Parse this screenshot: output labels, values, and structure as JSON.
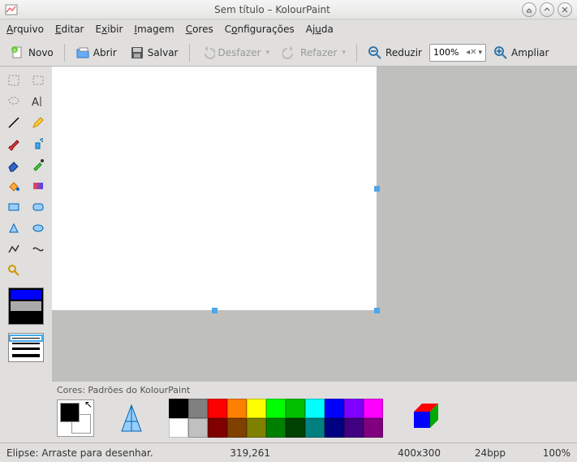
{
  "window": {
    "title": "Sem título – KolourPaint"
  },
  "menu": {
    "arquivo": "Arquivo",
    "editar": "Editar",
    "exibir": "Exibir",
    "imagem": "Imagem",
    "cores": "Cores",
    "config": "Configurações",
    "ajuda": "Ajuda"
  },
  "toolbar": {
    "novo": "Novo",
    "abrir": "Abrir",
    "salvar": "Salvar",
    "desfazer": "Desfazer",
    "refazer": "Refazer",
    "reduzir": "Reduzir",
    "ampliar": "Ampliar",
    "zoom": "100%"
  },
  "colorpanel": {
    "title": "Cores: Padrões do KolourPaint"
  },
  "palette": {
    "row1": [
      "#000000",
      "#808080",
      "#ff0000",
      "#ff8000",
      "#ffff00",
      "#00ff00",
      "#00c000",
      "#00ffff",
      "#0000ff",
      "#8000ff",
      "#ff00ff"
    ],
    "row2": [
      "#ffffff",
      "#c0c0c0",
      "#800000",
      "#804000",
      "#808000",
      "#008000",
      "#004000",
      "#008080",
      "#000080",
      "#400080",
      "#800080"
    ]
  },
  "status": {
    "hint": "Elipse: Arraste para desenhar.",
    "pos": "319,261",
    "dims": "400x300",
    "depth": "24bpp",
    "zoom": "100%"
  }
}
